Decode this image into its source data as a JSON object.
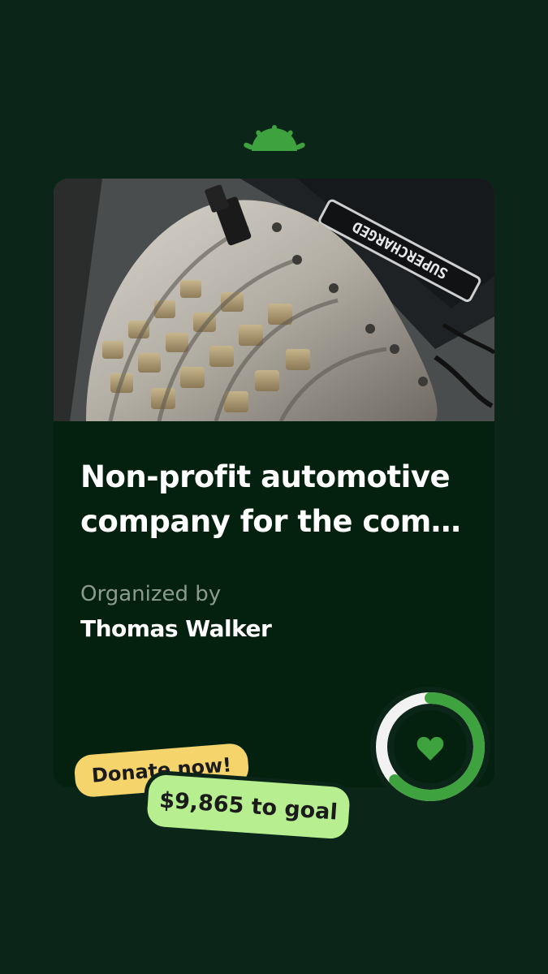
{
  "brand": {
    "logo_icon": "sunrise-logo-icon",
    "accent_color": "#3ea33e"
  },
  "fundraiser": {
    "image_alt": "supercharger-engine-photo",
    "engine_badge_text": "SUPERCHARGED",
    "title_line1": "Non-profit automotive",
    "title_line2": "company for the comm...",
    "organized_label": "Organized by",
    "organizer_name": "Thomas Walker",
    "progress_fraction": 0.63,
    "progress_color": "#3ea33e",
    "heart_icon": "heart-icon"
  },
  "cta": {
    "donate_label": "Donate now!",
    "goal_label": "$9,865 to goal",
    "donate_color": "#f5d46b",
    "goal_color": "#b6ee90"
  }
}
